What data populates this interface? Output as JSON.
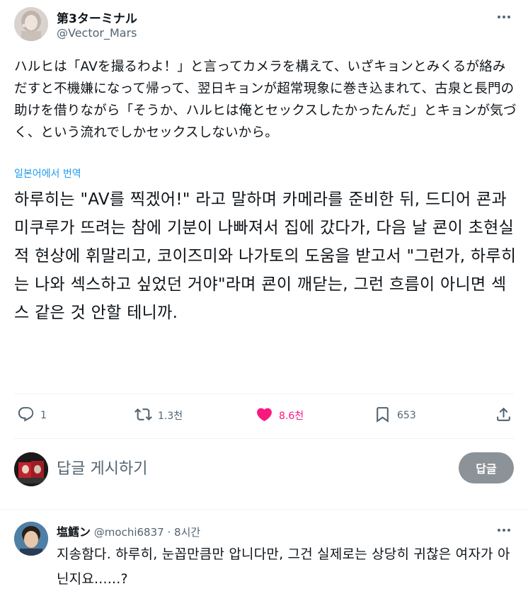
{
  "post": {
    "author_name": "第3ターミナル",
    "author_handle": "@Vector_Mars",
    "text": "ハルヒは「AVを撮るわよ！」と言ってカメラを構えて、いざキョンとみくるが絡みだすと不機嫌になって帰って、翌日キョンが超常現象に巻き込まれて、古泉と長門の助けを借りながら「そうか、ハルヒは俺とセックスしたかったんだ」とキョンが気づく、という流れでしかセックスしないから。",
    "translate_label": "일본어에서 번역",
    "translation": "하루히는 \"AV를 찍겠어!\" 라고 말하며 카메라를 준비한 뒤, 드디어 쿈과 미쿠루가 뜨려는 참에 기분이 나빠져서 집에 갔다가, 다음 날 쿈이 초현실적 현상에 휘말리고, 코이즈미와 나가토의 도움을 받고서 \"그런가, 하루히는 나와 섹스하고 싶었던 거야\"라며 쿈이 깨닫는, 그런 흐름이 아니면 섹스 같은 것 안할 테니까."
  },
  "actions": {
    "reply_count": "1",
    "repost_count": "1.3천",
    "like_count": "8.6천",
    "bookmark_count": "653"
  },
  "composer": {
    "placeholder": "답글 게시하기",
    "button_label": "답글"
  },
  "reply": {
    "name": "塩鱈ン",
    "handle": "@mochi6837",
    "separator": "·",
    "time": "8시간",
    "text": "지송함다. 하루히, 눈꼽만큼만 압니다만, 그건 실제로는 상당히 귀찮은 여자가 아닌지요......?"
  },
  "colors": {
    "accent": "#1d9bf0",
    "like": "#f91880",
    "secondary_text": "#536471",
    "reply_button": "#8b9298"
  },
  "icons": [
    "more-icon",
    "reply-icon",
    "repost-icon",
    "heart-icon",
    "bookmark-icon",
    "share-icon"
  ]
}
